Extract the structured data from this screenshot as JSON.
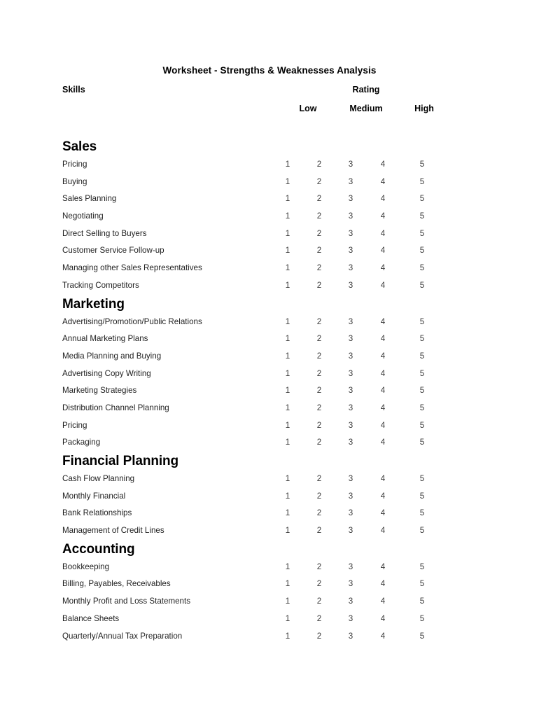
{
  "document": {
    "title": "Worksheet - Strengths & Weaknesses Analysis",
    "skills_header": "Skills",
    "rating_header": "Rating",
    "scale_labels": {
      "low": "Low",
      "medium": "Medium",
      "high": "High"
    },
    "rating_points": [
      "1",
      "2",
      "3",
      "4",
      "5"
    ],
    "text_color": "#1a1a1a",
    "page_background": "#ffffff"
  },
  "sections": [
    {
      "heading": "Sales",
      "skills": [
        "Pricing",
        "Buying",
        "Sales Planning",
        "Negotiating",
        "Direct Selling to Buyers",
        "Customer Service Follow-up",
        "Managing other Sales Representatives",
        "Tracking Competitors"
      ]
    },
    {
      "heading": "Marketing",
      "skills": [
        "Advertising/Promotion/Public Relations",
        "Annual Marketing Plans",
        "Media Planning and Buying",
        "Advertising Copy Writing",
        "Marketing Strategies",
        "Distribution Channel Planning",
        "Pricing",
        "Packaging"
      ]
    },
    {
      "heading": "Financial Planning",
      "skills": [
        "Cash Flow Planning",
        "Monthly Financial",
        "Bank Relationships",
        "Management of Credit Lines"
      ]
    },
    {
      "heading": "Accounting",
      "skills": [
        "Bookkeeping",
        "Billing, Payables, Receivables",
        "Monthly Profit and Loss Statements",
        "Balance Sheets",
        "Quarterly/Annual Tax Preparation"
      ]
    }
  ]
}
